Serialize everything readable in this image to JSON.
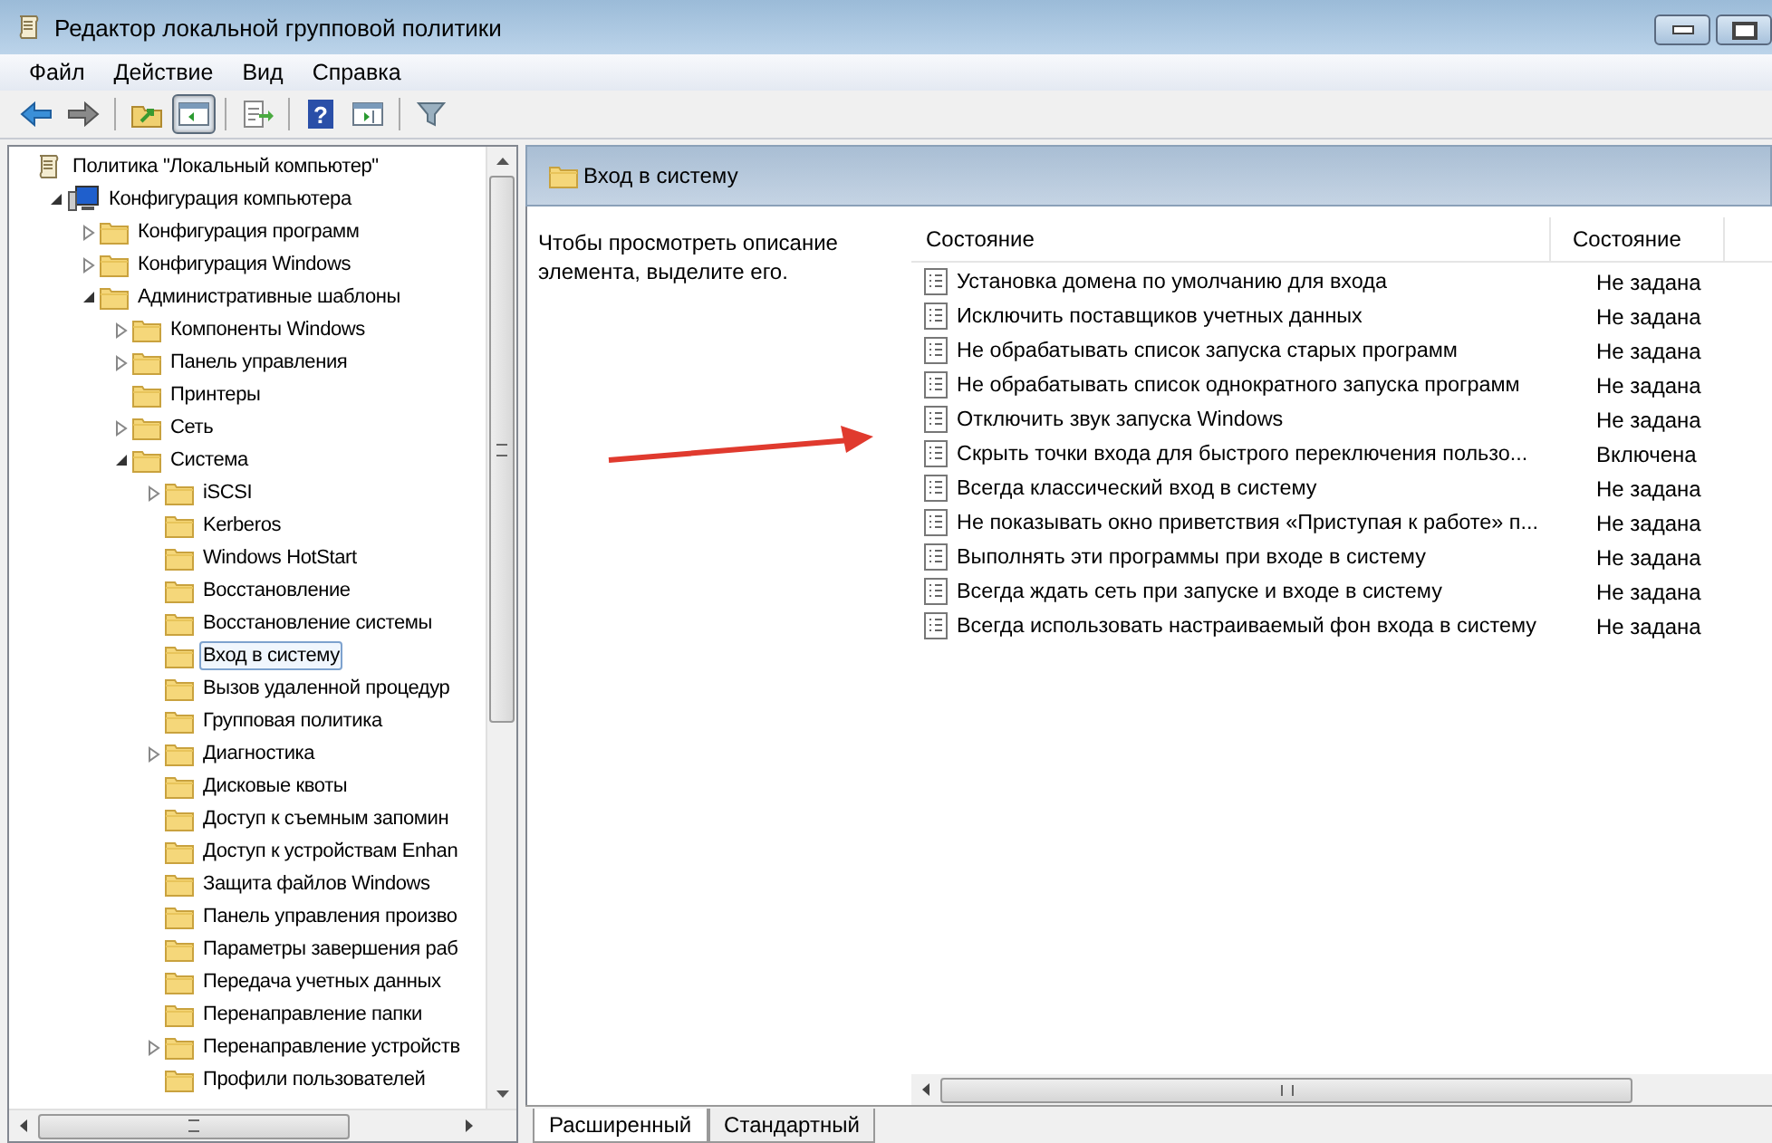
{
  "window": {
    "title": "Редактор локальной групповой политики"
  },
  "menu": [
    "Файл",
    "Действие",
    "Вид",
    "Справка"
  ],
  "toolbar": [
    {
      "kind": "back",
      "pressed": false
    },
    {
      "kind": "forward",
      "pressed": false
    },
    {
      "kind": "sep"
    },
    {
      "kind": "up",
      "pressed": false
    },
    {
      "kind": "tree",
      "pressed": true
    },
    {
      "kind": "sep"
    },
    {
      "kind": "export",
      "pressed": false
    },
    {
      "kind": "sep"
    },
    {
      "kind": "help",
      "pressed": false,
      "label": "?"
    },
    {
      "kind": "actionpane",
      "pressed": false
    },
    {
      "kind": "sep"
    },
    {
      "kind": "filter",
      "pressed": false
    }
  ],
  "tree": [
    {
      "label": "Политика \"Локальный компьютер\"",
      "kind": "policy",
      "selected": false,
      "children": [
        {
          "label": "Конфигурация компьютера",
          "kind": "computer",
          "selected": false,
          "expanded": true,
          "children": [
            {
              "label": "Конфигурация программ",
              "kind": "folder",
              "selected": false,
              "expanded": false
            },
            {
              "label": "Конфигурация Windows",
              "kind": "folder",
              "selected": false,
              "expanded": false
            },
            {
              "label": "Административные шаблоны",
              "kind": "folder",
              "selected": false,
              "expanded": true,
              "children": [
                {
                  "label": "Компоненты Windows",
                  "kind": "folder",
                  "selected": false,
                  "expanded": false
                },
                {
                  "label": "Панель управления",
                  "kind": "folder",
                  "selected": false,
                  "expanded": false
                },
                {
                  "label": "Принтеры",
                  "kind": "folder",
                  "selected": false
                },
                {
                  "label": "Сеть",
                  "kind": "folder",
                  "selected": false,
                  "expanded": false
                },
                {
                  "label": "Система",
                  "kind": "folder",
                  "selected": false,
                  "expanded": true,
                  "children": [
                    {
                      "label": "iSCSI",
                      "kind": "folder",
                      "selected": false,
                      "expanded": false
                    },
                    {
                      "label": "Kerberos",
                      "kind": "folder",
                      "selected": false
                    },
                    {
                      "label": "Windows HotStart",
                      "kind": "folder",
                      "selected": false
                    },
                    {
                      "label": "Восстановление",
                      "kind": "folder",
                      "selected": false
                    },
                    {
                      "label": "Восстановление системы",
                      "kind": "folder",
                      "selected": false
                    },
                    {
                      "label": "Вход в систему",
                      "kind": "folder",
                      "selected": true
                    },
                    {
                      "label": "Вызов удаленной процедур",
                      "kind": "folder",
                      "selected": false
                    },
                    {
                      "label": "Групповая политика",
                      "kind": "folder",
                      "selected": false
                    },
                    {
                      "label": "Диагностика",
                      "kind": "folder",
                      "selected": false,
                      "expanded": false
                    },
                    {
                      "label": "Дисковые квоты",
                      "kind": "folder",
                      "selected": false
                    },
                    {
                      "label": "Доступ к съемным запомин",
                      "kind": "folder",
                      "selected": false
                    },
                    {
                      "label": "Доступ к устройствам Enhan",
                      "kind": "folder",
                      "selected": false
                    },
                    {
                      "label": "Защита файлов Windows",
                      "kind": "folder",
                      "selected": false
                    },
                    {
                      "label": "Панель управления произво",
                      "kind": "folder",
                      "selected": false
                    },
                    {
                      "label": "Параметры завершения раб",
                      "kind": "folder",
                      "selected": false
                    },
                    {
                      "label": "Передача учетных данных",
                      "kind": "folder",
                      "selected": false
                    },
                    {
                      "label": "Перенаправление папки",
                      "kind": "folder",
                      "selected": false
                    },
                    {
                      "label": "Перенаправление устройств",
                      "kind": "folder",
                      "selected": false,
                      "expanded": false
                    },
                    {
                      "label": "Профили пользователей",
                      "kind": "folder",
                      "selected": false
                    }
                  ]
                }
              ]
            }
          ]
        }
      ]
    }
  ],
  "header": {
    "title": "Вход в систему"
  },
  "description": "Чтобы просмотреть описание элемента, выделите его.",
  "table": {
    "columns": [
      "Состояние",
      "Состояние"
    ],
    "rows": [
      {
        "name": "Установка домена по умолчанию для входа",
        "state": "Не задана"
      },
      {
        "name": "Исключить поставщиков учетных данных",
        "state": "Не задана"
      },
      {
        "name": "Не обрабатывать список запуска старых программ",
        "state": "Не задана"
      },
      {
        "name": "Не обрабатывать список однократного запуска программ",
        "state": "Не задана"
      },
      {
        "name": "Отключить звук запуска Windows",
        "state": "Не задана"
      },
      {
        "name": "Скрыть точки входа для быстрого переключения пользо...",
        "state": "Включена"
      },
      {
        "name": "Всегда классический вход в систему",
        "state": "Не задана"
      },
      {
        "name": "Не показывать окно приветствия «Приступая к работе» п...",
        "state": "Не задана"
      },
      {
        "name": "Выполнять эти программы при входе в систему",
        "state": "Не задана"
      },
      {
        "name": "Всегда ждать сеть при запуске и входе в систему",
        "state": "Не задана"
      },
      {
        "name": "Всегда использовать настраиваемый фон входа в систему",
        "state": "Не задана"
      }
    ]
  },
  "tabs": [
    {
      "label": "Расширенный",
      "selected": true
    },
    {
      "label": "Стандартный",
      "selected": false
    }
  ]
}
